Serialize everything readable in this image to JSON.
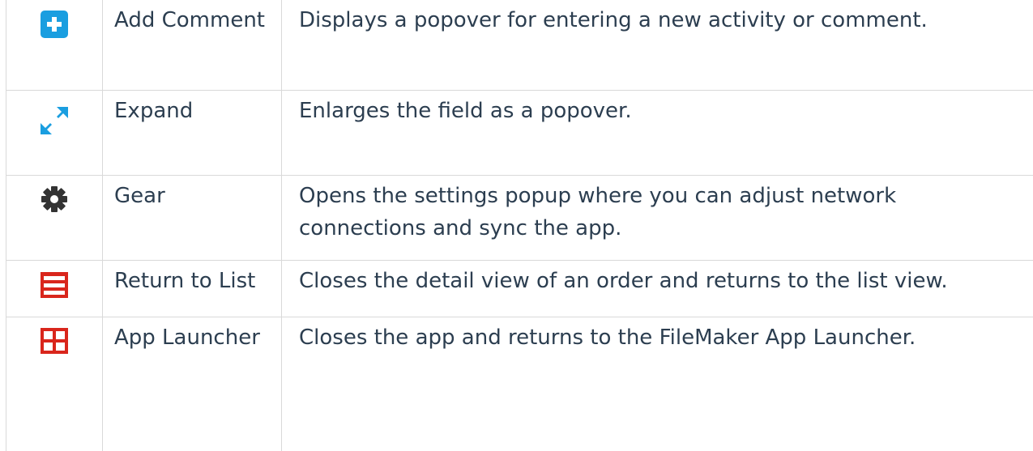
{
  "rows": [
    {
      "icon": "add-comment-icon",
      "name": "Add Comment",
      "description": "Displays a popover for entering a new activity or comment."
    },
    {
      "icon": "expand-icon",
      "name": "Expand",
      "description": "Enlarges the field as a popover."
    },
    {
      "icon": "gear-icon",
      "name": "Gear",
      "description": "Opens the settings popup where you can adjust network connections and sync the app."
    },
    {
      "icon": "list-icon",
      "name": "Return to List",
      "description": "Closes the detail view of an order and returns to the list view."
    },
    {
      "icon": "app-launcher-icon",
      "name": "App Launcher",
      "description": "Closes the app and returns to the FileMaker App Launcher."
    }
  ],
  "colors": {
    "text": "#2c3e50",
    "border": "#d9d9d9",
    "add_icon_bg": "#1a9ee0",
    "expand_icon": "#1a9ee0",
    "gear_icon": "#333333",
    "red_icon_bg": "#d9261c"
  }
}
